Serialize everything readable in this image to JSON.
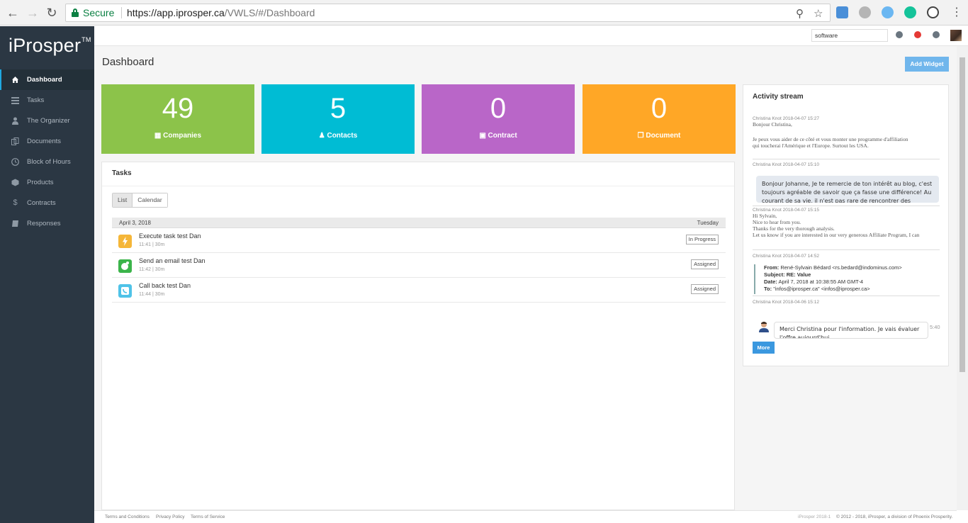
{
  "browser": {
    "secure_label": "Secure",
    "url_host": "https://app.iprosper.ca",
    "url_path": "/VWLS/#/Dashboard"
  },
  "app": {
    "logo": "iProsper",
    "logo_tm": "TM"
  },
  "sidebar": {
    "items": [
      {
        "label": "Dashboard",
        "icon": "home-icon",
        "active": true
      },
      {
        "label": "Tasks",
        "icon": "tasks-icon"
      },
      {
        "label": "The Organizer",
        "icon": "person-icon"
      },
      {
        "label": "Documents",
        "icon": "documents-icon"
      },
      {
        "label": "Block of Hours",
        "icon": "clock-icon"
      },
      {
        "label": "Products",
        "icon": "box-icon"
      },
      {
        "label": "Contracts",
        "icon": "dollar-icon"
      },
      {
        "label": "Responses",
        "icon": "book-icon"
      }
    ]
  },
  "topbar": {
    "search_value": "software"
  },
  "page": {
    "title": "Dashboard",
    "add_widget_label": "Add Widget"
  },
  "stats": [
    {
      "value": "49",
      "label": "Companies",
      "color": "#8cc34a",
      "icon": "building-icon"
    },
    {
      "value": "5",
      "label": "Contacts",
      "color": "#00bcd4",
      "icon": "user-icon"
    },
    {
      "value": "0",
      "label": "Contract",
      "color": "#b966c8",
      "icon": "briefcase-icon"
    },
    {
      "value": "0",
      "label": "Document",
      "color": "#ffa726",
      "icon": "copy-icon"
    }
  ],
  "tasks": {
    "title": "Tasks",
    "view_list": "List",
    "view_calendar": "Calendar",
    "date": "April 3, 2018",
    "weekday": "Tuesday",
    "rows": [
      {
        "name": "Execute task test Dan",
        "meta": "11:41 | 30m",
        "status": "In Progress",
        "icon": "bolt-icon",
        "icon_color": "#f5b638"
      },
      {
        "name": "Send an email test Dan",
        "meta": "11:42 | 30m",
        "status": "Assigned",
        "icon": "email-icon",
        "icon_color": "#3bb44a"
      },
      {
        "name": "Call back test Dan",
        "meta": "11:44 | 30m",
        "status": "Assigned",
        "icon": "phone-icon",
        "icon_color": "#4fc3e8"
      }
    ]
  },
  "activity": {
    "title": "Activity stream",
    "entries": [
      {
        "meta": "Christina Knot 2018-04-07 15:27",
        "line1": "Bonjour Christina,",
        "line2": "Je peux vous aider de ce côté et vous monter une programme d'affiliation",
        "line3": "qui toucherai l'Amérique et l'Europe.  Surtout les USA."
      },
      {
        "meta": "Christina Knot 2018-04-07 15:10",
        "bubble": "Bonjour Johanne, Je te remercie de ton intérêt au blog, c'est toujours agréable de savoir que ça fasse une différence! Au courant de sa vie, il n'est pas rare de rencontrer des obstacles (des cailloux) sur notre chemin. On a envoyé l'information."
      },
      {
        "meta": "Christina Knot 2018-04-07 15:15",
        "line1": "Hi Sylvain,",
        "line2": "Nice to hear from you.",
        "line3": "Thanks for the very thorough analysis.",
        "line4": "Let us know if you are interested in our very generous Affiliate Program, I can"
      },
      {
        "meta": "Christina Knot 2018-04-07 14:52",
        "from_label": "From:",
        "from": "René-Sylvain Bédard <rs.bedard@indominus.com>",
        "subject_label": "Subject:",
        "subject": "RE: Value",
        "date_label": "Date:",
        "date": "April 7, 2018 at 10:38:55 AM GMT-4",
        "to_label": "To:",
        "to": "\"infos@iprosper.ca\" <infos@iprosper.ca>"
      },
      {
        "meta": "Christina Knot 2018-04-06 15:12",
        "bubble": "Merci Christina pour l'information. Je vais évaluer l'offre aujourd'hui.",
        "time": "5:40"
      }
    ],
    "more_label": "More"
  },
  "footer": {
    "terms": "Terms and Conditions",
    "privacy": "Privacy Policy",
    "service": "Terms of Service",
    "version": "iProsper 2018-1",
    "copyright": "© 2012 - 2018, iProsper, a division of Phoenix Prosperity."
  }
}
